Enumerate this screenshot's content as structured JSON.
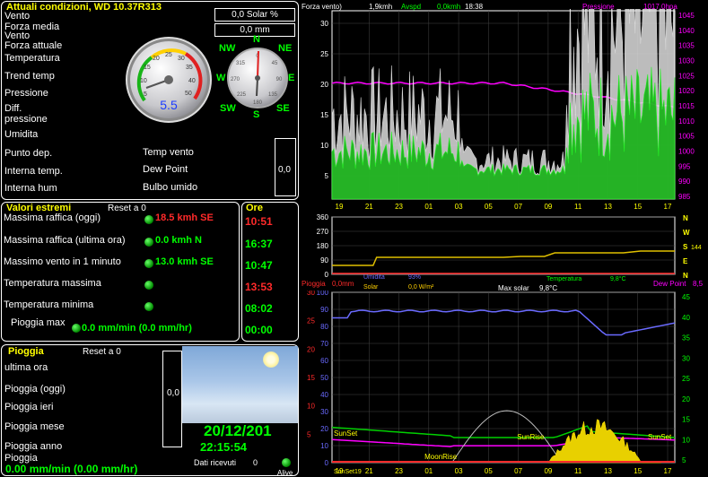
{
  "current": {
    "title": "Attuali condizioni, WD 10.37R313",
    "solar_value": "0,0 Solar %",
    "rain_value": "0,0 mm",
    "side_value": "0,0",
    "labels": [
      "Vento",
      "Forza media",
      "Vento",
      "Forza attuale",
      "Temperatura",
      "Trend temp",
      "Pressione",
      "Diff.",
      "pressione",
      "Umidita",
      "Punto dep.",
      "Interna temp.",
      "Interna hum"
    ],
    "right_labels": [
      "Temp vento",
      "Dew Point",
      "Bulbo umido"
    ],
    "gauge_value": "5.5",
    "compass": {
      "n": "N",
      "ne": "NE",
      "e": "E",
      "se": "SE",
      "s": "S",
      "sw": "SW",
      "w": "W",
      "nw": "NW"
    }
  },
  "extremes": {
    "title": "Valori estremi",
    "reset": "Reset a 0",
    "ore_title": "Ore",
    "rows": [
      {
        "label": "Massima raffica (oggi)",
        "value": "18.5 kmh SE",
        "time": "10:51",
        "color": "#ff2a2a"
      },
      {
        "label": "Massima raffica (ultima ora)",
        "value": "0.0 kmh N",
        "time": "16:37",
        "color": "#00ff00"
      },
      {
        "label": "Massimo vento in 1 minuto",
        "value": "13.0 kmh SE",
        "time": "10:47",
        "color": "#00ff00"
      },
      {
        "label": "Temperatura massima",
        "value": "",
        "time": "13:53",
        "color": "#ff2a2a"
      },
      {
        "label": "Temperatura minima",
        "value": "",
        "time": "08:02",
        "color": "#00ff00"
      },
      {
        "label": "Pioggia max",
        "value": "0.0 mm/min (0.0 mm/hr)",
        "time": "00:00",
        "color": "#00ff00"
      }
    ]
  },
  "rain": {
    "title": "Pioggia",
    "reset": "Reset a 0",
    "labels": [
      "ultima ora",
      "Pioggia (oggi)",
      "Pioggia ieri",
      "Pioggia mese",
      "Pioggia anno",
      "Pioggia"
    ],
    "value": "0.00 mm/min (0.00 mm/hr)",
    "side_value": "0,0",
    "date": "20/12/201",
    "time": "22:15:54",
    "received": "Dati ricevuti",
    "received_value": "0",
    "alive": "Alive"
  },
  "chart_top": {
    "header_left": "Forza vento)",
    "header_speed": "1,9kmh",
    "header_avspd_label": "Avspd",
    "header_avspd": "0,0kmh",
    "header_time": "18:38",
    "header_pressure_label": "Pressione",
    "header_pressure": "1017,0hpa",
    "left_ticks": [
      "5",
      "10",
      "15",
      "20",
      "25",
      "30"
    ],
    "right_ticks": [
      "985",
      "990",
      "995",
      "1000",
      "1005",
      "1010",
      "1015",
      "1020",
      "1025",
      "1030",
      "1035",
      "1040",
      "1045"
    ],
    "x_ticks": [
      "19",
      "21",
      "23",
      "01",
      "03",
      "05",
      "07",
      "09",
      "11",
      "13",
      "15",
      "17"
    ]
  },
  "chart_dir": {
    "left_ticks": [
      "0",
      "90",
      "180",
      "270",
      "360"
    ],
    "right_letters": [
      "N",
      "W",
      "S",
      "E",
      "N"
    ],
    "right_value": "144",
    "footer_umidita": "Umidita",
    "footer_umidita_val": "93%",
    "footer_solar": "Solar",
    "footer_solar_val": "0,0 W/m²",
    "footer_temp": "Temperatura",
    "footer_temp_val": "9,8°C"
  },
  "chart_bottom": {
    "header_rain": "Pioggia",
    "header_rain_val": "0,0mm",
    "header_solar": "Max solar",
    "header_solar_val": "9,8°C",
    "header_dew": "Dew Point",
    "header_dew_val": "8,5",
    "left_ticks": [
      "0",
      "5",
      "10",
      "15",
      "20",
      "25",
      "30",
      "35",
      "40",
      "45",
      "50",
      "55",
      "60",
      "65",
      "70",
      "75",
      "80",
      "85",
      "90",
      "95",
      "100"
    ],
    "right_ticks": [
      "5",
      "10",
      "15",
      "20",
      "25",
      "30",
      "35",
      "40",
      "45"
    ],
    "rain_ticks": [
      "5",
      "10",
      "15",
      "20",
      "25",
      "30"
    ],
    "x_ticks": [
      "19",
      "21",
      "23",
      "01",
      "03",
      "05",
      "07",
      "09",
      "11",
      "13",
      "15",
      "17"
    ],
    "sunset": "SunSet",
    "sunrise": "SunRise",
    "moonrise": "MoonRise",
    "sunset2": "SunSet",
    "sunset_bottom": "SunSet19"
  },
  "colors": {
    "yellow": "#ffff00",
    "magenta": "#ff00ff",
    "blue": "#6a6aff",
    "green": "#00ff00",
    "red": "#ff2a2a"
  }
}
